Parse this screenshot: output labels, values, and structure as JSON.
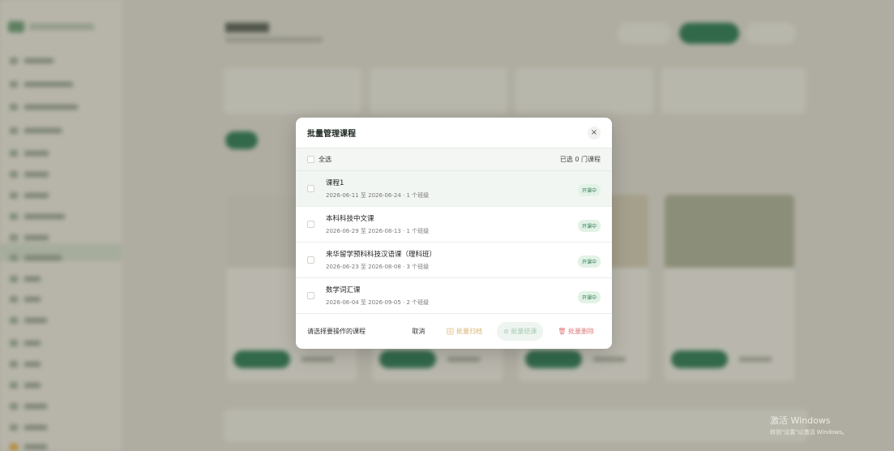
{
  "modal": {
    "title": "批量管理课程",
    "close_icon": "×",
    "select_all_label": "全选",
    "selected_count": "已选 0 门课程",
    "courses": [
      {
        "name": "课程1",
        "dates": "2026-06-11 至 2026-06-24 · 1 个班级",
        "status": "开课中"
      },
      {
        "name": "本科科技中文课",
        "dates": "2026-06-29 至 2026-08-13 · 1 个班级",
        "status": "开课中"
      },
      {
        "name": "来华留学预科科技汉语课（理科班）",
        "dates": "2026-06-23 至 2026-08-08 · 3 个班级",
        "status": "开课中"
      },
      {
        "name": "数学词汇课",
        "dates": "2026-06-04 至 2026-09-05 · 2 个班级",
        "status": "开课中"
      }
    ],
    "footer": {
      "hint": "请选择要操作的课程",
      "cancel": "取消",
      "archive": "🗄 批量归档",
      "end": "⊘ 批量结课",
      "delete": "🗑 批量删除"
    }
  },
  "watermark": {
    "line1": "激活 Windows",
    "line2": "转到\"设置\"以激活 Windows。"
  },
  "colors": {
    "accent": "#2f7a55",
    "badge_bg": "#e2f2e6"
  }
}
